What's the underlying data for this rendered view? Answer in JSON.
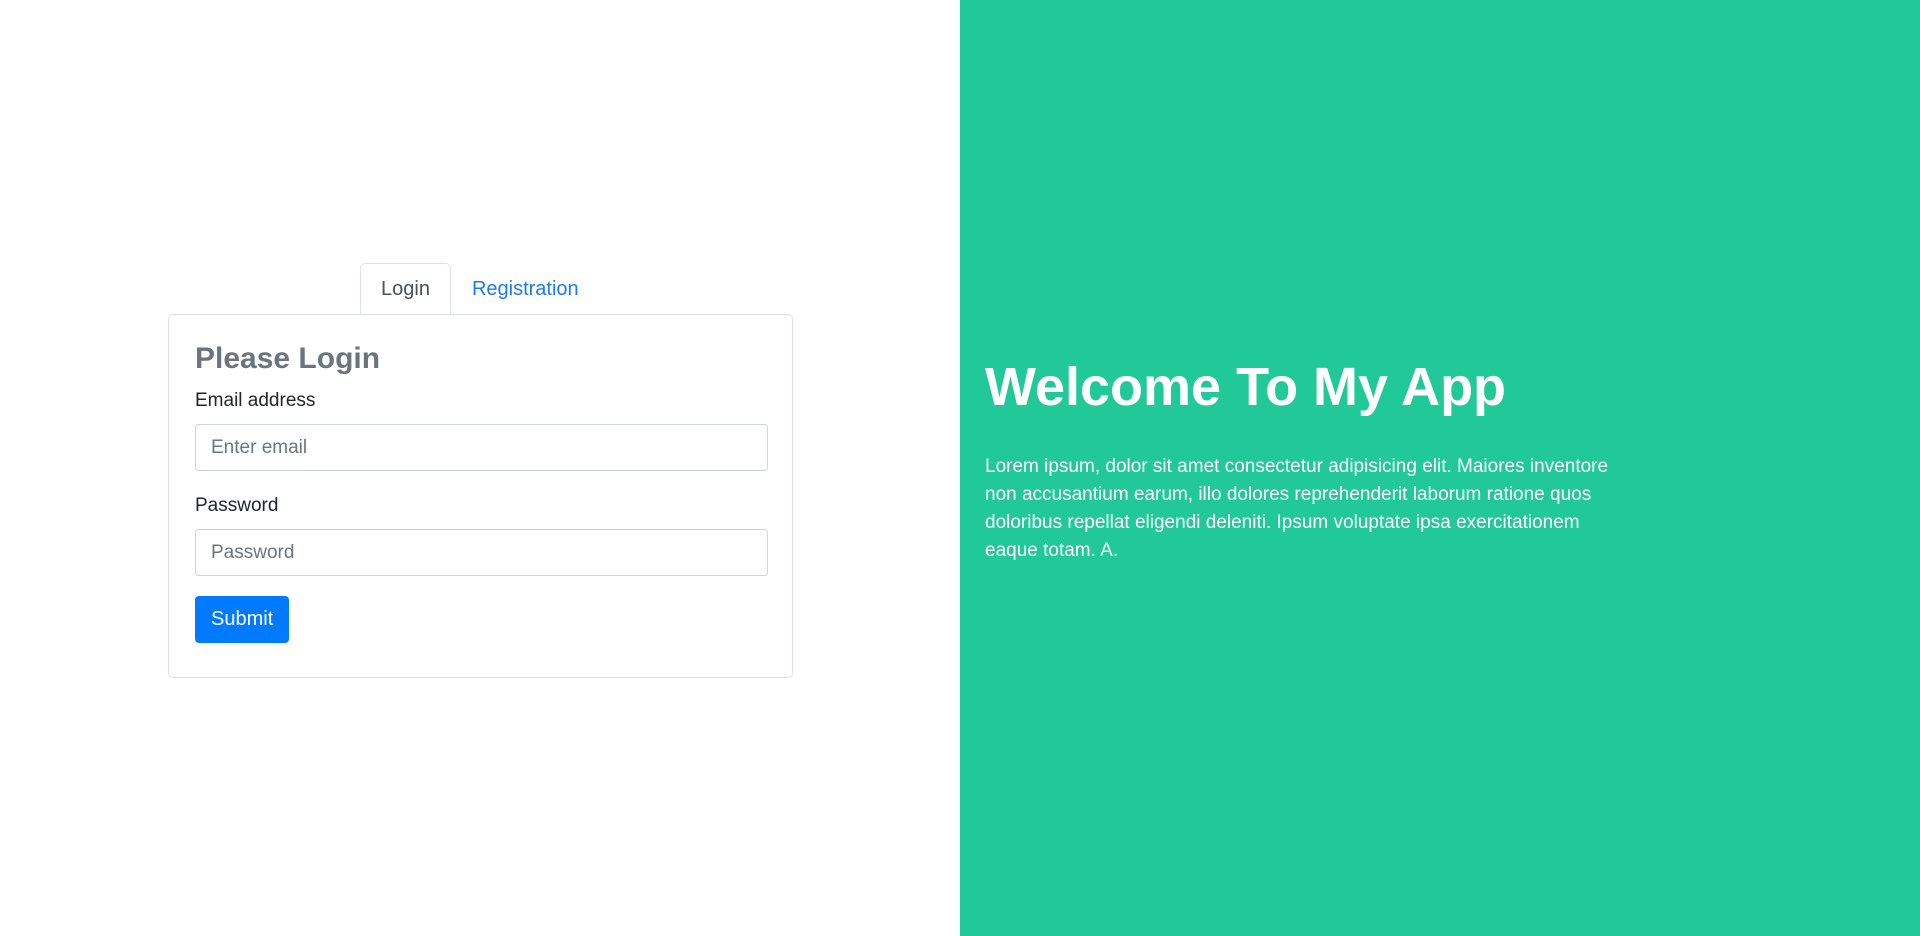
{
  "tabs": {
    "login_label": "Login",
    "registration_label": "Registration",
    "active": "Login"
  },
  "login_card": {
    "title": "Please Login",
    "email_label": "Email address",
    "email_placeholder": "Enter email",
    "email_value": "",
    "password_label": "Password",
    "password_placeholder": "Password",
    "password_value": "",
    "submit_label": "Submit"
  },
  "welcome": {
    "title": "Welcome To My App",
    "body": "Lorem ipsum, dolor sit amet consectetur adipisicing elit. Maiores inventore non accusantium earum, illo dolores reprehenderit laborum ratione quos doloribus repellat eligendi deleniti. Ipsum voluptate ipsa exercitationem eaque totam. A."
  },
  "colors": {
    "accent_panel": "#21c998",
    "primary_button": "#007bff",
    "tab_link": "#1f7be6"
  }
}
